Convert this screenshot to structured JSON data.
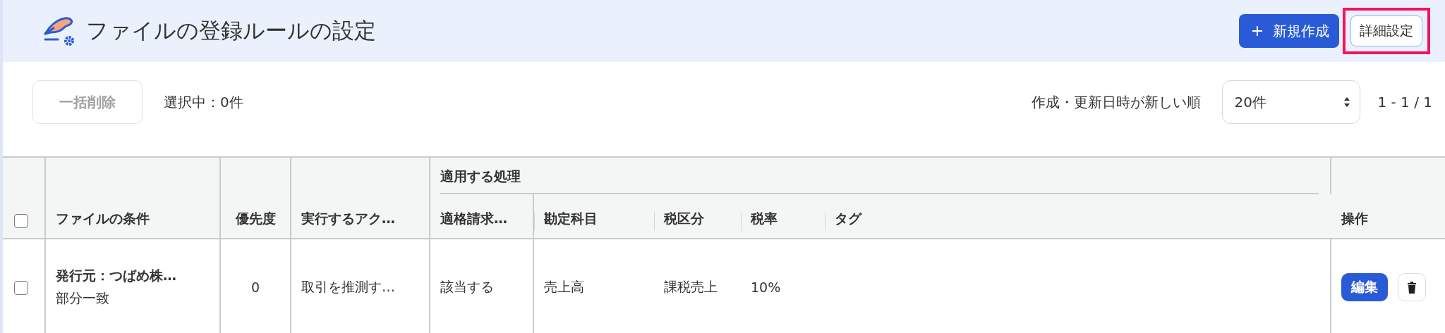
{
  "header": {
    "title": "ファイルの登録ルールの設定",
    "new_button": {
      "label": "新規作成"
    },
    "detail_button": {
      "label": "詳細設定",
      "highlighted": true
    }
  },
  "toolbar": {
    "bulk_delete": {
      "label": "一括削除",
      "disabled": true
    },
    "selection_count": "選択中：0件",
    "sort_label": "作成・更新日時が新しい順",
    "per_page": {
      "value": "20件"
    },
    "pagination": "1 - 1 / 1"
  },
  "table": {
    "select_all": {
      "checked": false
    },
    "columns": [
      "ファイルの条件",
      "優先度",
      "実行するアク…"
    ],
    "group": {
      "label": "適用する処理",
      "columns": [
        "適格請求…",
        "勘定科目",
        "税区分",
        "税率",
        "タグ"
      ]
    },
    "actions_column": "操作",
    "rows": [
      {
        "checked": false,
        "condition": "発行元：つばめ株…",
        "match": "部分一致",
        "priority": "0",
        "action": "取引を推測す…",
        "invoice": "該当する",
        "account": "売上高",
        "tax_category": "課税売上",
        "tax_rate": "10%",
        "edit_label": "編集"
      }
    ]
  }
}
